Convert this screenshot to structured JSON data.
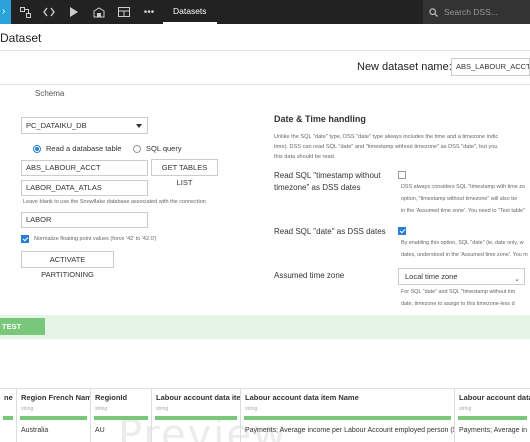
{
  "nav": {
    "datasets_label": "Datasets",
    "search_placeholder": "Search DSS...",
    "icons": [
      "flow-icon",
      "code-icon",
      "run-icon",
      "bundle-icon",
      "dashboard-icon",
      "more-icon"
    ]
  },
  "header": {
    "title": "Dataset",
    "new_dataset_label": "New dataset name:",
    "new_dataset_value": "ABS_LABOUR_ACCT"
  },
  "tabs": {
    "schema": "Schema"
  },
  "form": {
    "connection": "PC_DATAIKU_DB",
    "mode_table": "Read a database table",
    "mode_sql": "SQL query",
    "table_name": "ABS_LABOUR_ACCT",
    "get_tables_label": "GET TABLES LIST",
    "database": "LABOR_DATA_ATLAS",
    "database_hint": "Leave blank to use the Snowflake database associated with the connection",
    "schema": "LABOR",
    "normalize_label": "Normalize floating point values (force '42' to '42.0')",
    "activate_partitioning": "ACTIVATE PARTITIONING"
  },
  "datetime": {
    "title": "Date & Time handling",
    "desc_lines": [
      "Unlike the SQL \"date\" type, DSS \"date\" type always includes the time and a timezone indic",
      "time). DSS can read SQL \"date\" and \"timestamp without timezone\" as DSS \"date\", but you",
      "this data should be read."
    ],
    "opt1_label_1": "Read SQL \"timestamp without",
    "opt1_label_2": "timezone\" as DSS dates",
    "opt1_help": [
      "DSS always considers SQL \"timestamp with time zo",
      "option, \"timestamp without timezone\" will also be",
      "in the 'Assumed time zone'. You need to \"Test table\""
    ],
    "opt2_label": "Read SQL \"date\" as DSS dates",
    "opt2_help": [
      "By enabling this option, SQL \"date\" (ie, date only, w",
      "dates, understood in the 'Assumed time zone'. You m"
    ],
    "tz_label": "Assumed time zone",
    "tz_value": "Local time zone",
    "tz_help": [
      "For SQL \"date\" and SQL \"timestamp without tim",
      "date, timezone to assign to this timezone-less d"
    ]
  },
  "test_again_label": "TEST AGAIN",
  "preview": {
    "columns": [
      {
        "name": "ne",
        "type": "",
        "value": ""
      },
      {
        "name": "Region French Name",
        "type": "string",
        "value": "Australia"
      },
      {
        "name": "RegionId",
        "type": "string",
        "value": "AU"
      },
      {
        "name": "Labour account data item",
        "type": "string",
        "value": ""
      },
      {
        "name": "Labour account data item Name",
        "type": "string",
        "value": "Payments; Average income per Labour Account employed person ($)"
      },
      {
        "name": "Labour account data i",
        "type": "string",
        "value": "Payments; Average in"
      }
    ],
    "watermark": "Preview"
  },
  "colors": {
    "accent_blue": "#2aa3db",
    "green": "#79c879",
    "topbar": "#222222"
  }
}
